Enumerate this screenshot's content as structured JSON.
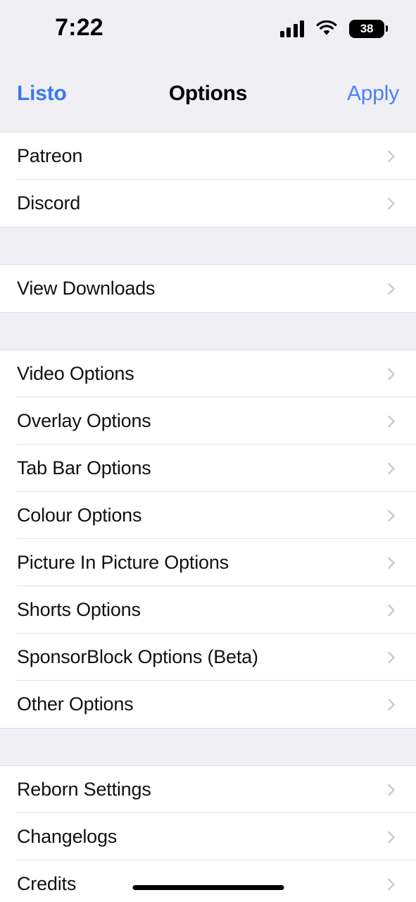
{
  "status_bar": {
    "time": "7:22",
    "signal_icon": "cellular-signal-icon",
    "signal_bars_filled": 4,
    "wifi_icon": "wifi-icon",
    "battery_icon": "battery-icon",
    "battery_percent": "38"
  },
  "nav_bar": {
    "back_label": "Listo",
    "title": "Options",
    "action_label": "Apply",
    "tint_color": "#3a7af0"
  },
  "sections": [
    {
      "id": "links",
      "rows": [
        {
          "label": "Patreon",
          "accessory": "chevron-right-icon"
        },
        {
          "label": "Discord",
          "accessory": "chevron-right-icon"
        }
      ]
    },
    {
      "id": "downloads",
      "rows": [
        {
          "label": "View Downloads",
          "accessory": "chevron-right-icon"
        }
      ]
    },
    {
      "id": "options",
      "rows": [
        {
          "label": "Video Options",
          "accessory": "chevron-right-icon"
        },
        {
          "label": "Overlay Options",
          "accessory": "chevron-right-icon"
        },
        {
          "label": "Tab Bar Options",
          "accessory": "chevron-right-icon"
        },
        {
          "label": "Colour Options",
          "accessory": "chevron-right-icon"
        },
        {
          "label": "Picture In Picture Options",
          "accessory": "chevron-right-icon"
        },
        {
          "label": "Shorts Options",
          "accessory": "chevron-right-icon"
        },
        {
          "label": "SponsorBlock Options (Beta)",
          "accessory": "chevron-right-icon"
        },
        {
          "label": "Other Options",
          "accessory": "chevron-right-icon"
        }
      ]
    },
    {
      "id": "about",
      "rows": [
        {
          "label": "Reborn Settings",
          "accessory": "chevron-right-icon"
        },
        {
          "label": "Changelogs",
          "accessory": "chevron-right-icon"
        },
        {
          "label": "Credits",
          "accessory": "chevron-right-icon"
        }
      ]
    }
  ],
  "home_indicator": "home-indicator"
}
